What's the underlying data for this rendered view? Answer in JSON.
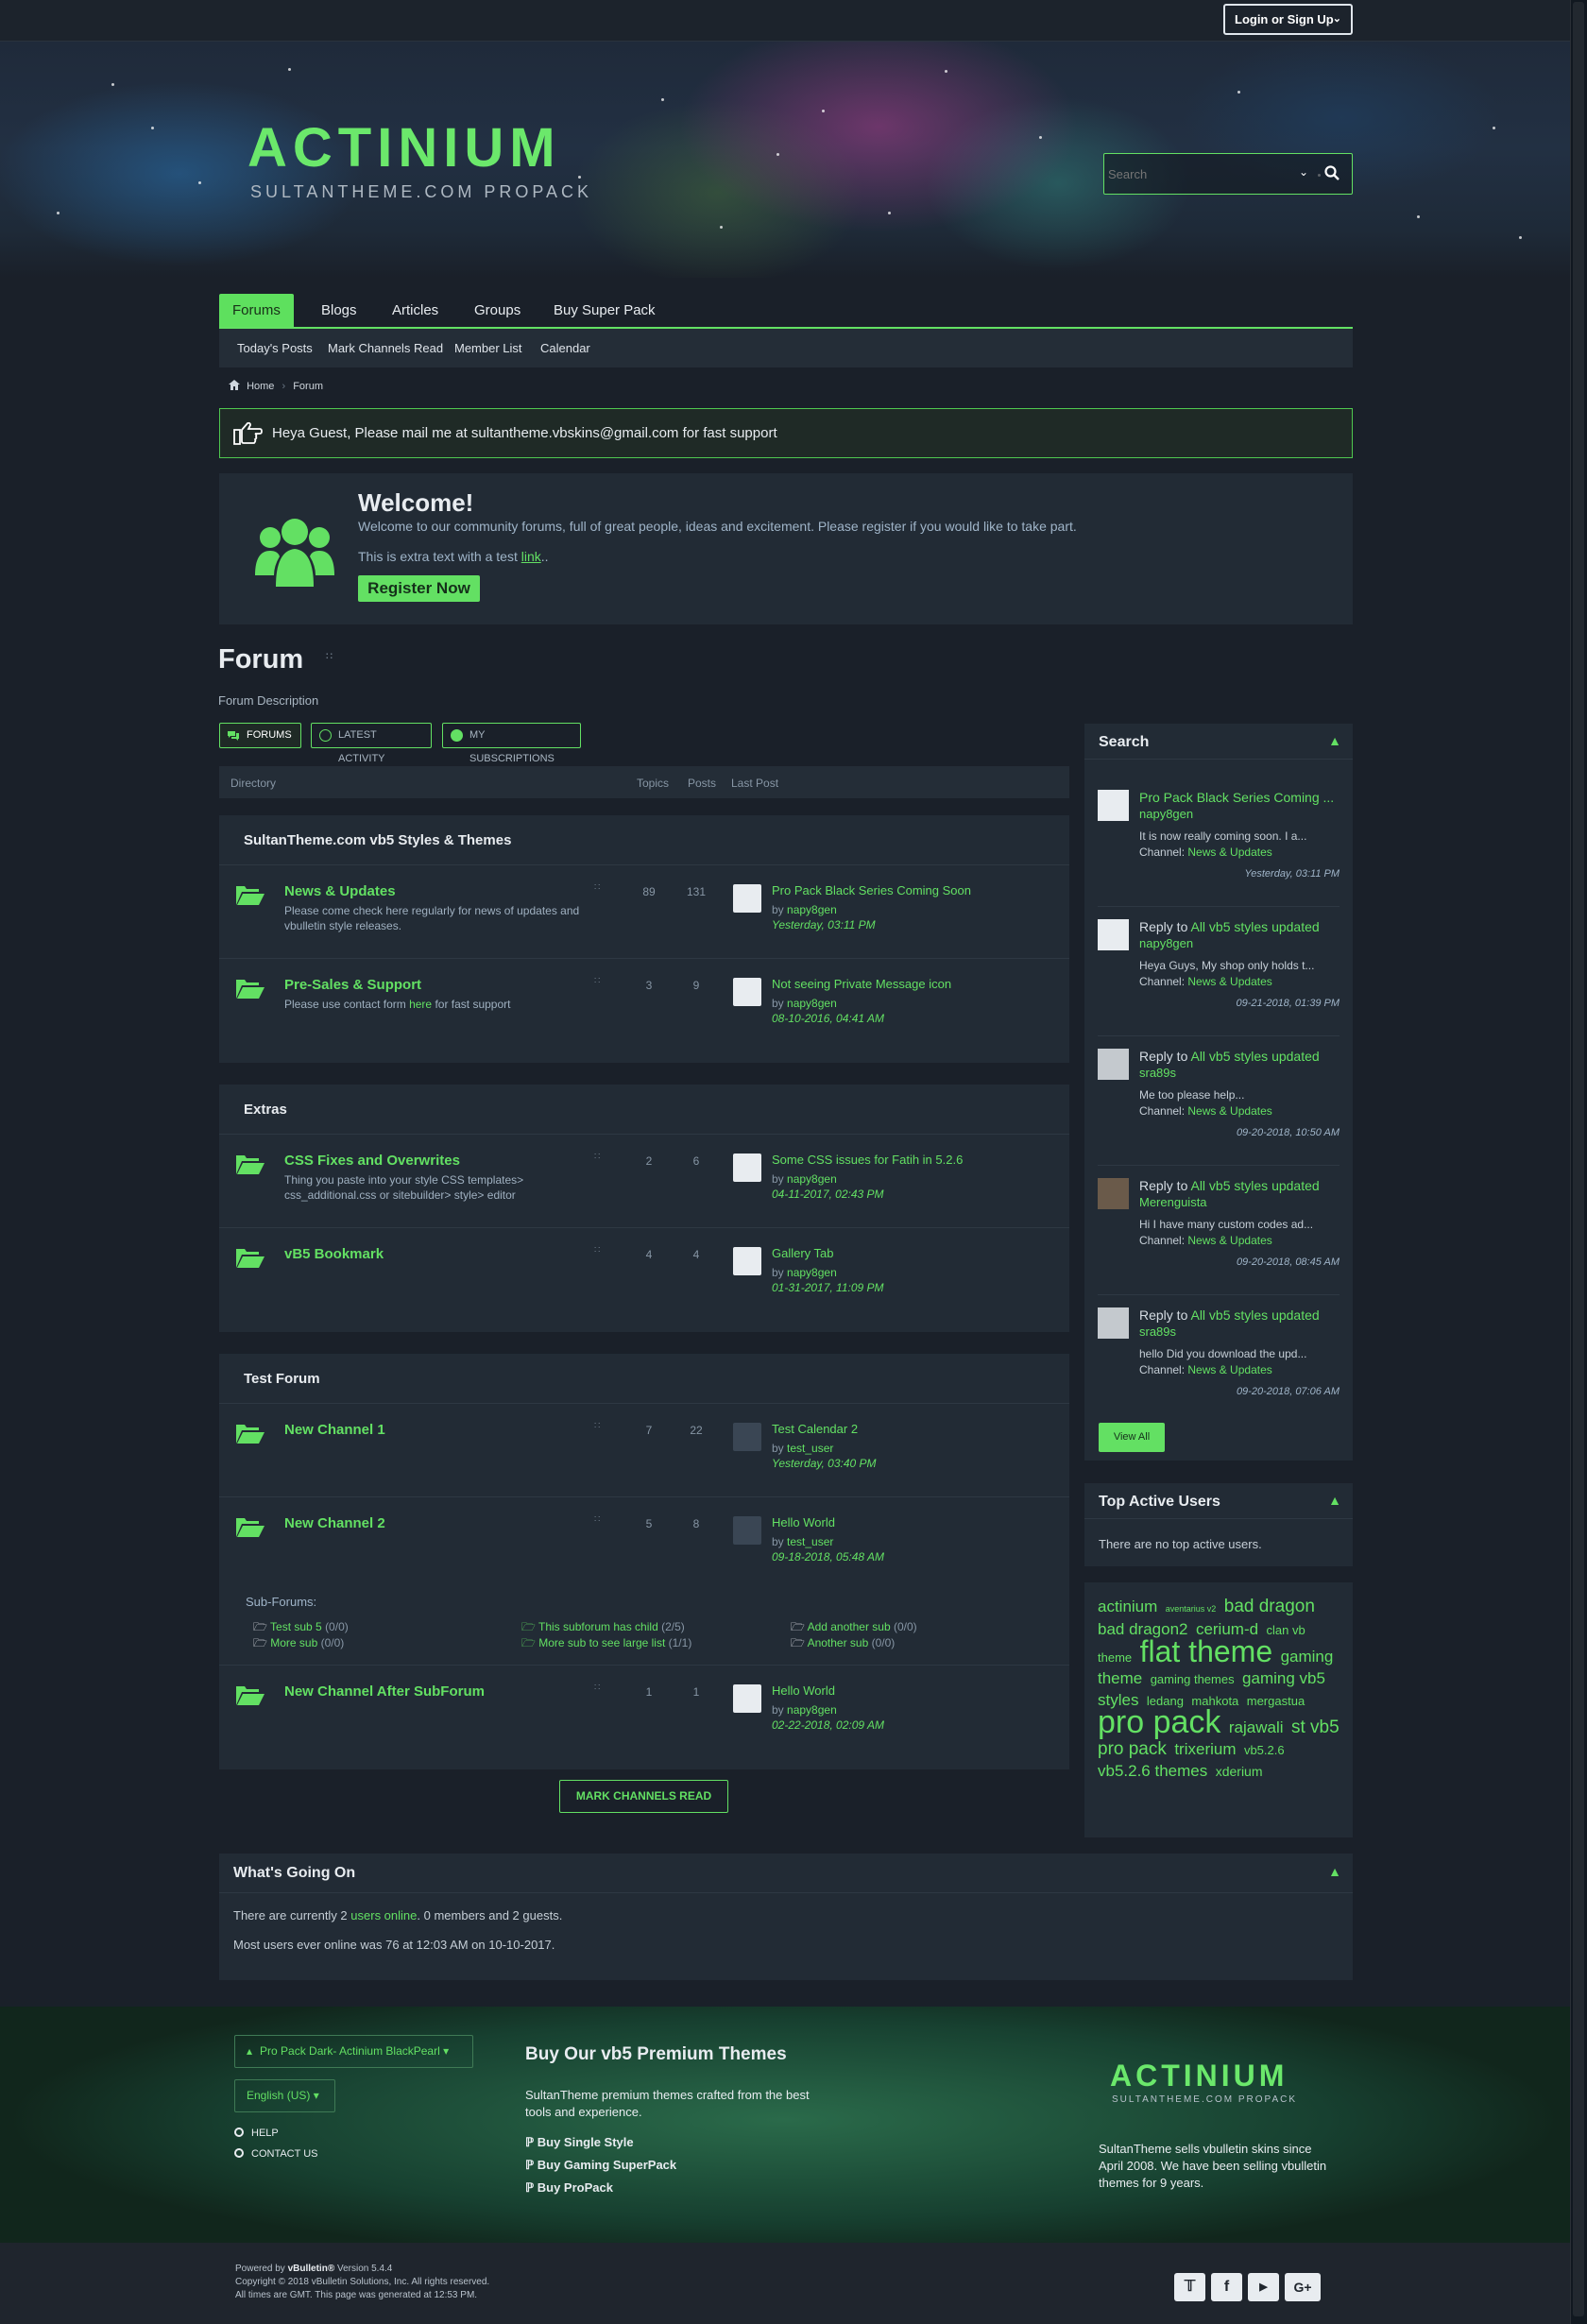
{
  "topbar": {
    "login_label": "Login or Sign Up"
  },
  "header": {
    "logo_title": "ACTINIUM",
    "logo_subtitle": "SULTANTHEME.COM PROPACK",
    "search_placeholder": "Search"
  },
  "nav": {
    "tabs": [
      "Forums",
      "Blogs",
      "Articles",
      "Groups",
      "Buy Super Pack"
    ],
    "subnav": [
      "Today's Posts",
      "Mark Channels Read",
      "Member List",
      "Calendar"
    ]
  },
  "breadcrumb": {
    "home": "Home",
    "current": "Forum"
  },
  "notice": "Heya Guest, Please mail me at sultantheme.vbskins@gmail.com for fast support",
  "welcome": {
    "title": "Welcome!",
    "desc": "Welcome to our community forums, full of great people, ideas and excitement. Please register if you would like to take part.",
    "extra_pre": "This is extra text with a test ",
    "extra_link": "link",
    "extra_post": "..",
    "register": "Register Now"
  },
  "page": {
    "title": "Forum",
    "description": "Forum Description",
    "tabs": [
      "Forums",
      "Latest Activity",
      "My Subscriptions"
    ]
  },
  "columns": {
    "directory": "Directory",
    "topics": "Topics",
    "posts": "Posts",
    "last_post": "Last Post"
  },
  "sections": [
    {
      "title": "SultanTheme.com vb5 Styles & Themes"
    },
    {
      "title": "Extras"
    },
    {
      "title": "Test Forum"
    }
  ],
  "channels": [
    {
      "title": "News & Updates",
      "desc": "Please come check here regularly for news of updates and vbulletin style releases.",
      "topics": "89",
      "posts": "131",
      "lp_title": "Pro Pack Black Series Coming Soon",
      "lp_by": "by",
      "lp_user": "napy8gen",
      "lp_date": "Yesterday, 03:11 PM"
    },
    {
      "title": "Pre-Sales & Support",
      "desc_pre": "Please use contact form ",
      "desc_link": "here",
      "desc_post": " for fast support",
      "topics": "3",
      "posts": "9",
      "lp_title": "Not seeing Private Message icon",
      "lp_by": "by",
      "lp_user": "napy8gen",
      "lp_date": "08-10-2016, 04:41 AM"
    },
    {
      "title": "CSS Fixes and Overwrites",
      "desc": "Thing you paste into your style CSS templates> css_additional.css or sitebuilder> style> editor",
      "topics": "2",
      "posts": "6",
      "lp_title": "Some CSS issues for Fatih in 5.2.6",
      "lp_by": "by",
      "lp_user": "napy8gen",
      "lp_date": "04-11-2017, 02:43 PM"
    },
    {
      "title": "vB5 Bookmark",
      "desc": "",
      "topics": "4",
      "posts": "4",
      "lp_title": "Gallery Tab",
      "lp_by": "by",
      "lp_user": "napy8gen",
      "lp_date": "01-31-2017, 11:09 PM"
    },
    {
      "title": "New Channel 1",
      "desc": "",
      "topics": "7",
      "posts": "22",
      "lp_title": "Test Calendar 2",
      "lp_by": "by",
      "lp_user": "test_user",
      "lp_date": "Yesterday, 03:40 PM"
    },
    {
      "title": "New Channel 2",
      "desc": "",
      "topics": "5",
      "posts": "8",
      "lp_title": "Hello World",
      "lp_by": "by",
      "lp_user": "test_user",
      "lp_date": "09-18-2018, 05:48 AM"
    },
    {
      "title": "New Channel After SubForum",
      "desc": "",
      "topics": "1",
      "posts": "1",
      "lp_title": "Hello World",
      "lp_by": "by",
      "lp_user": "napy8gen",
      "lp_date": "02-22-2018, 02:09 AM"
    }
  ],
  "subforums": {
    "label": "Sub-Forums:",
    "items": [
      {
        "name": "Test sub 5",
        "count": "(0/0)"
      },
      {
        "name": "More sub",
        "count": "(0/0)"
      },
      {
        "name": "This subforum has child",
        "count": "(2/5)"
      },
      {
        "name": "More sub to see large list",
        "count": "(1/1)"
      },
      {
        "name": "Add another sub",
        "count": "(0/0)"
      },
      {
        "name": "Another sub",
        "count": "(0/0)"
      }
    ]
  },
  "mark_read": "Mark Channels Read",
  "sidebar": {
    "search_title": "Search",
    "activity": [
      {
        "line1": "Pro Pack Black Series Coming ...",
        "user": "napy8gen",
        "excerpt": "It is now really coming soon. I a...",
        "channel_label": "Channel: ",
        "channel": "News & Updates",
        "date": "Yesterday, 03:11 PM"
      },
      {
        "line1_pre": "Reply to ",
        "line1": "All vb5 styles updated",
        "user": "napy8gen",
        "excerpt": "Heya Guys, My shop only holds t...",
        "channel_label": "Channel: ",
        "channel": "News & Updates",
        "date": "09-21-2018, 01:39 PM"
      },
      {
        "line1_pre": "Reply to ",
        "line1": "All vb5 styles updated",
        "user": "sra89s",
        "excerpt": "Me too please help...",
        "channel_label": "Channel: ",
        "channel": "News & Updates",
        "date": "09-20-2018, 10:50 AM"
      },
      {
        "line1_pre": "Reply to ",
        "line1": "All vb5 styles updated",
        "user": "Merenguista",
        "excerpt": "Hi I have many custom codes ad...",
        "channel_label": "Channel: ",
        "channel": "News & Updates",
        "date": "09-20-2018, 08:45 AM"
      },
      {
        "line1_pre": "Reply to ",
        "line1": "All vb5 styles updated",
        "user": "sra89s",
        "excerpt": "hello Did you download the upd...",
        "channel_label": "Channel: ",
        "channel": "News & Updates",
        "date": "09-20-2018, 07:06 AM"
      }
    ],
    "view_all": "View All",
    "top_users_title": "Top Active Users",
    "top_users_empty": "There are no top active users.",
    "tags": [
      "actinium",
      "aventarius v2",
      "bad dragon",
      "bad dragon2",
      "cerium-d",
      "clan vb theme",
      "flat theme",
      "gaming theme",
      "gaming themes",
      "gaming vb5 styles",
      "ledang",
      "mahkota",
      "mergastua",
      "pro pack",
      "rajawali",
      "st vb5 pro pack",
      "trixerium",
      "vb5.2.6",
      "vb5.2.6 themes",
      "xderium"
    ]
  },
  "wgo": {
    "title": "What's Going On",
    "line1_pre": "There are currently 2 ",
    "line1_link": "users online",
    "line1_post": ". 0 members and 2 guests.",
    "line2": "Most users ever online was 76 at 12:03 AM on 10-10-2017."
  },
  "footer": {
    "style_select": "Pro Pack Dark- Actinium BlackPearl",
    "lang_select": "English (US)",
    "links": [
      "HELP",
      "CONTACT US"
    ],
    "buy_title": "Buy Our vb5 Premium Themes",
    "buy_text": "SultanTheme premium themes crafted from the best tools and experience.",
    "buy_links": [
      "Buy Single Style",
      "Buy Gaming SuperPack",
      "Buy ProPack"
    ],
    "logo_title": "ACTINIUM",
    "logo_subtitle": "SULTANTHEME.COM PROPACK",
    "about": "SultanTheme sells vbulletin skins since April 2008. We have been selling vbulletin themes for 9 years."
  },
  "copyright": {
    "line1_pre": "Powered by ",
    "line1_brand": "vBulletin®",
    "line1_post": " Version 5.4.4",
    "line2": "Copyright © 2018 vBulletin Solutions, Inc. All rights reserved.",
    "line3": "All times are GMT. This page was generated at 12:53 PM."
  },
  "colors": {
    "accent": "#63e063",
    "background": "#1a2029",
    "panel": "#222b35"
  }
}
